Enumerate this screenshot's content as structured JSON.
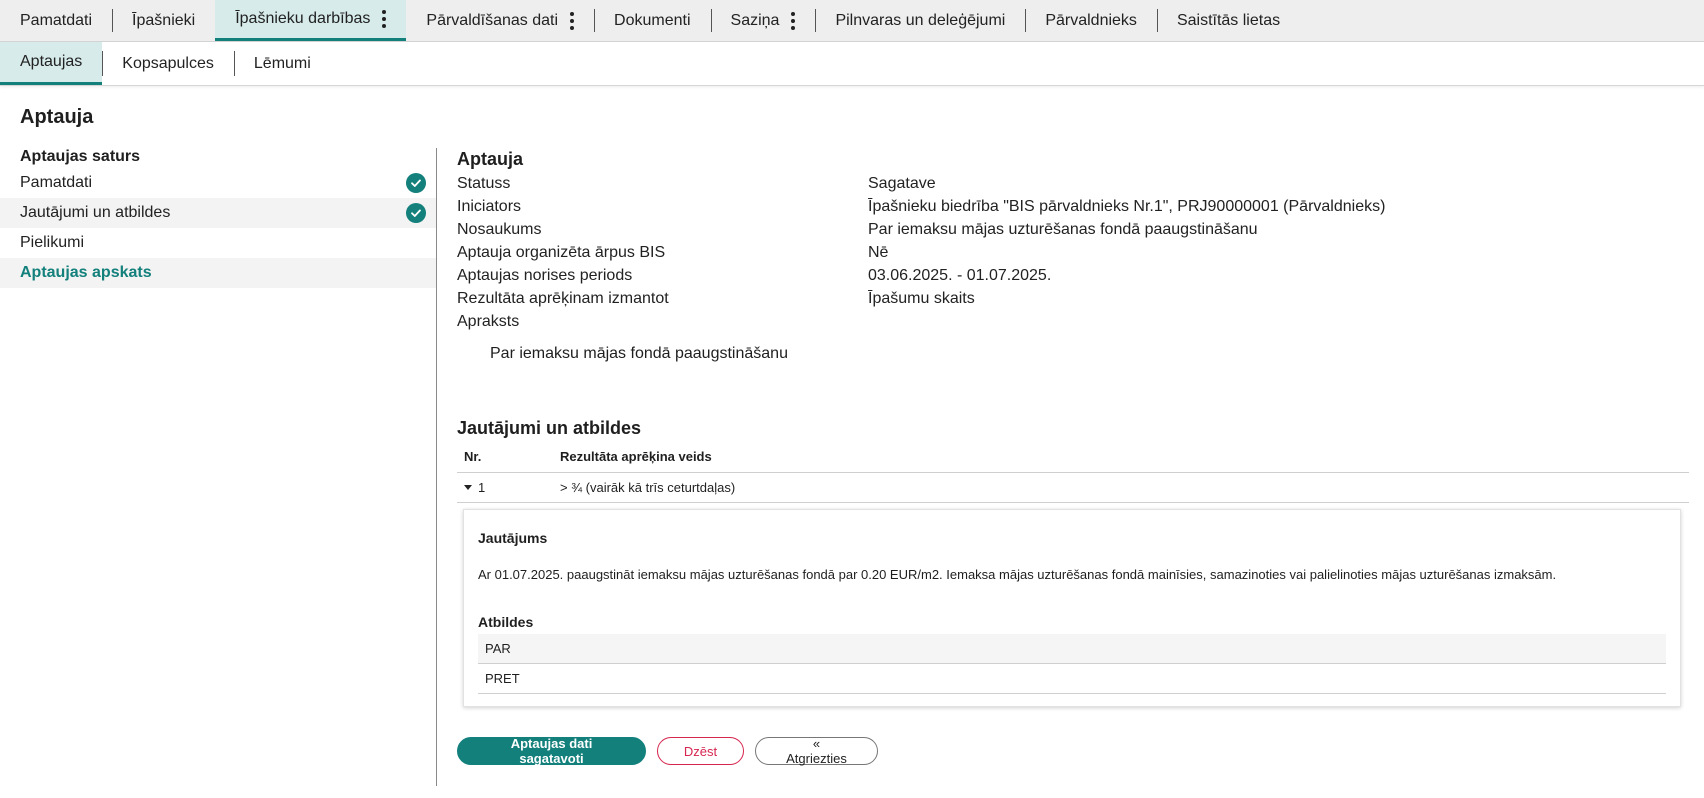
{
  "top_tabs": [
    {
      "label": "Pamatdati",
      "active": false,
      "menu": false
    },
    {
      "label": "Īpašnieki",
      "active": false,
      "menu": false
    },
    {
      "label": "Īpašnieku darbības",
      "active": true,
      "menu": true
    },
    {
      "label": "Pārvaldīšanas dati",
      "active": false,
      "menu": true
    },
    {
      "label": "Dokumenti",
      "active": false,
      "menu": false
    },
    {
      "label": "Saziņa",
      "active": false,
      "menu": true
    },
    {
      "label": "Pilnvaras un deleģējumi",
      "active": false,
      "menu": false
    },
    {
      "label": "Pārvaldnieks",
      "active": false,
      "menu": false
    },
    {
      "label": "Saistītās lietas",
      "active": false,
      "menu": false
    }
  ],
  "sub_tabs": [
    {
      "label": "Aptaujas",
      "active": true
    },
    {
      "label": "Kopsapulces",
      "active": false
    },
    {
      "label": "Lēmumi",
      "active": false
    }
  ],
  "page_title": "Aptauja",
  "sidebar": {
    "heading": "Aptaujas saturs",
    "items": [
      {
        "label": "Pamatdati",
        "done": true
      },
      {
        "label": "Jautājumi un atbildes",
        "done": true
      },
      {
        "label": "Pielikumi",
        "done": false
      },
      {
        "label": "Aptaujas apskats",
        "done": false
      }
    ]
  },
  "survey": {
    "title": "Aptauja",
    "fields": [
      {
        "label": "Statuss",
        "value": "Sagatave"
      },
      {
        "label": "Iniciators",
        "value": "Īpašnieku biedrība \"BIS pārvaldnieks Nr.1\", PRJ90000001 (Pārvaldnieks)"
      },
      {
        "label": "Nosaukums",
        "value": "Par iemaksu mājas uzturēšanas fondā paaugstināšanu"
      },
      {
        "label": "Aptauja organizēta ārpus BIS",
        "value": "Nē"
      },
      {
        "label": "Aptaujas norises periods",
        "value": "03.06.2025. - 01.07.2025."
      },
      {
        "label": "Rezultāta aprēķinam izmantot",
        "value": "Īpašumu skaits"
      },
      {
        "label": "Apraksts",
        "value": ""
      }
    ],
    "description": "Par iemaksu mājas fondā paaugstināšanu"
  },
  "questions": {
    "title": "Jautājumi un atbildes",
    "columns": {
      "nr": "Nr.",
      "calc": "Rezultāta aprēķina veids"
    },
    "row": {
      "nr": "1",
      "calc": "> ¾ (vairāk kā trīs ceturtdaļas)"
    },
    "detail": {
      "question_label": "Jautājums",
      "question_text": "Ar 01.07.2025. paaugstināt iemaksu mājas uzturēšanas fondā par 0.20 EUR/m2. Iemaksa mājas uzturēšanas fondā mainīsies, samazinoties vai palielinoties mājas uzturēšanas izmaksām.",
      "answers_label": "Atbildes",
      "answers": [
        "PAR",
        "PRET"
      ]
    }
  },
  "actions": {
    "primary": "Aptaujas dati sagatavoti",
    "delete": "Dzēst",
    "back": "« Atgriezties"
  },
  "colors": {
    "accent": "#13807c",
    "active_tab_bg": "#d6ebea",
    "danger": "#d6264f"
  }
}
